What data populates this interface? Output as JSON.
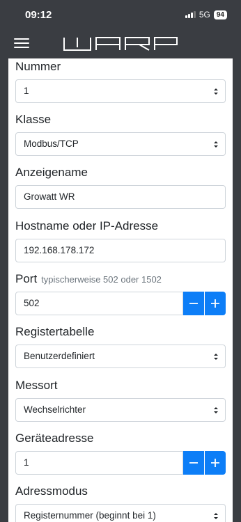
{
  "status": {
    "time": "09:12",
    "network": "5G",
    "battery": "94"
  },
  "app": {
    "logo_text": "WARP"
  },
  "fields": [
    {
      "label": "Nummer",
      "value": "1",
      "type": "select"
    },
    {
      "label": "Klasse",
      "value": "Modbus/TCP",
      "type": "select"
    },
    {
      "label": "Anzeigename",
      "value": "Growatt WR",
      "type": "text"
    },
    {
      "label": "Hostname oder IP-Adresse",
      "value": "192.168.178.172",
      "type": "text"
    },
    {
      "label": "Port",
      "hint": "typischerweise 502 oder 1502",
      "value": "502",
      "type": "stepper"
    },
    {
      "label": "Registertabelle",
      "value": "Benutzerdefiniert",
      "type": "select"
    },
    {
      "label": "Messort",
      "value": "Wechselrichter",
      "type": "select"
    },
    {
      "label": "Geräteadresse",
      "value": "1",
      "type": "stepper"
    },
    {
      "label": "Adressmodus",
      "value": "Registernummer (beginnt bei 1)",
      "type": "select"
    }
  ],
  "colors": {
    "navbar": "#3a3d42",
    "accent": "#0d7ef7"
  }
}
